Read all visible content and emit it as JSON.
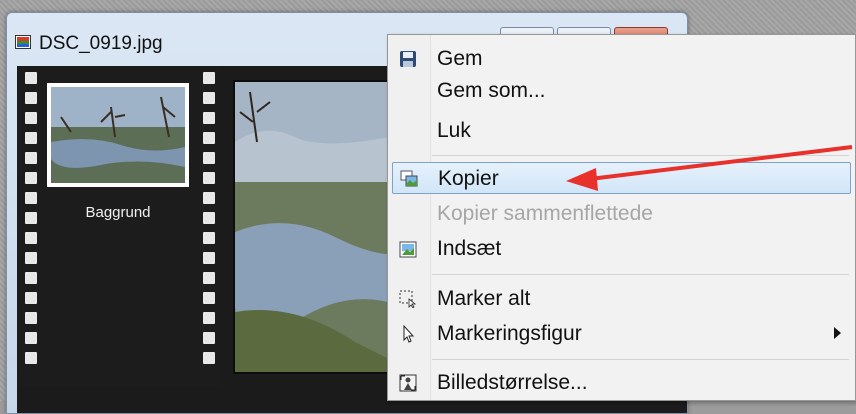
{
  "window": {
    "title": "DSC_0919.jpg"
  },
  "layers": {
    "thumb_label": "Baggrund"
  },
  "context_menu": {
    "items": [
      {
        "label": "Gem",
        "icon": "floppy-disk-icon",
        "enabled": true
      },
      {
        "label": "Gem som...",
        "icon": "",
        "enabled": true
      },
      {
        "label": "Luk",
        "icon": "",
        "enabled": true
      },
      {
        "label": "Kopier",
        "icon": "copy-image-icon",
        "enabled": true,
        "highlighted": true
      },
      {
        "label": "Kopier sammenflettede",
        "icon": "",
        "enabled": false
      },
      {
        "label": "Indsæt",
        "icon": "paste-image-icon",
        "enabled": true
      },
      {
        "label": "Marker alt",
        "icon": "select-all-icon",
        "enabled": true
      },
      {
        "label": "Markeringsfigur",
        "icon": "selection-cursor-icon",
        "enabled": true,
        "submenu": true
      },
      {
        "label": "Billedstørrelse...",
        "icon": "image-size-icon",
        "enabled": true
      }
    ]
  },
  "annotation": {
    "arrow_color": "#e8312a"
  },
  "colors": {
    "menu_highlight_border": "#7da2ce",
    "close_button": "#c8503b"
  }
}
